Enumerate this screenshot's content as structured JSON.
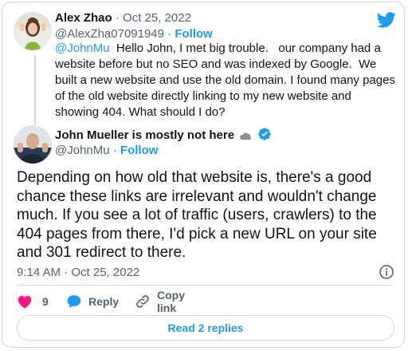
{
  "colors": {
    "accent": "#1d9bf0",
    "text": "#0f1419",
    "secondary": "#536471",
    "border": "#cfd9de",
    "like": "#f91880",
    "verified": "#1d9bf0"
  },
  "header": {
    "logo_icon": "twitter-bird-icon"
  },
  "reply_tweet": {
    "author_name": "Alex Zhao",
    "separator": "·",
    "date": "Oct 25, 2022",
    "handle": "@AlexZha07091949",
    "follow_label": "Follow",
    "mention": "@JohnMu",
    "text": "  Hello John, I met big trouble.   our company had a website before but no SEO and was indexed by Google.  We built a new website and use the old domain. I found many pages of the old website directly linking to my new website and showing 404. What should I do?",
    "avatar_icon": "user-avatar"
  },
  "main_tweet": {
    "author_name": "John Mueller is mostly not here",
    "name_emoji_icon": "cloud-icon",
    "verified_icon": "verified-badge-icon",
    "handle": "@JohnMu",
    "separator": "·",
    "follow_label": "Follow",
    "text": "Depending on how old that website is, there's a good chance these links are irrelevant and wouldn't change much. If you see a lot of traffic (users, crawlers) to the 404 pages from there, I'd pick a new URL on your site and 301 redirect to there.",
    "timestamp": "9:14 AM · Oct 25, 2022",
    "info_icon": "info-icon"
  },
  "actions": {
    "like_count": "9",
    "like_icon": "heart-icon",
    "reply_label": "Reply",
    "reply_icon": "reply-bubble-icon",
    "copy_label": "Copy link",
    "copy_icon": "link-icon"
  },
  "footer": {
    "read_replies_label": "Read 2 replies"
  }
}
